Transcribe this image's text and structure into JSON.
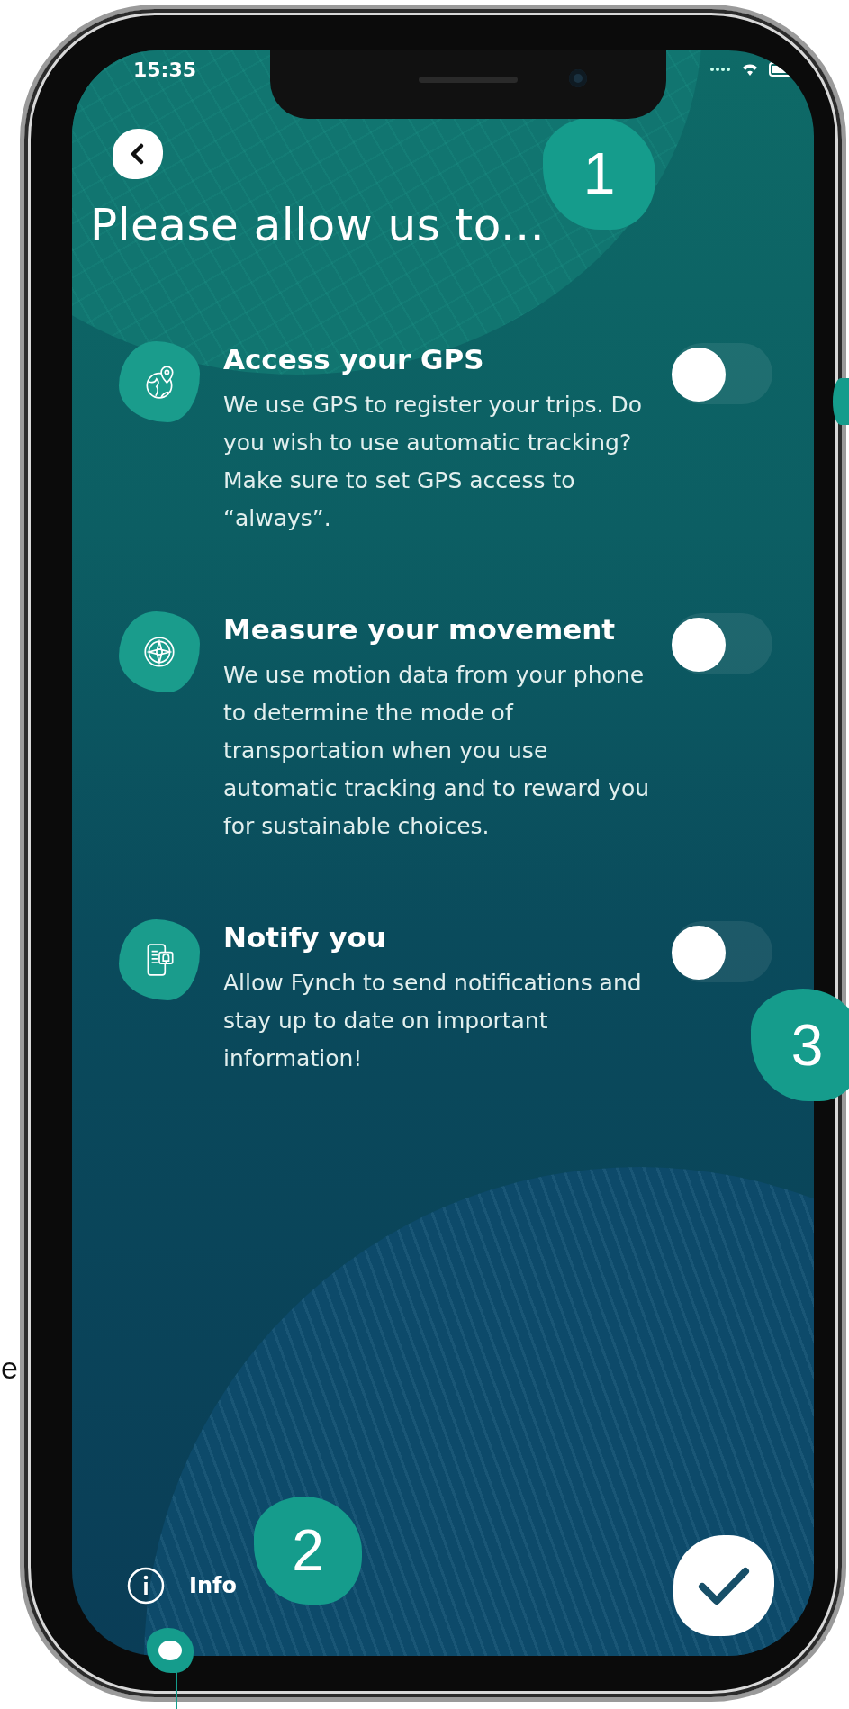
{
  "status_bar": {
    "time": "15:35"
  },
  "title": "Please allow us to...",
  "permissions": [
    {
      "kind": "gps",
      "title": "Access your GPS",
      "description": "We use GPS to register your trips. Do you wish to use automatic tracking? Make sure to set GPS access to “always”.",
      "on": false
    },
    {
      "kind": "motion",
      "title": "Measure your movement",
      "description": "We use motion data from your phone to determine the mode of transportation when you use automatic tracking and to reward you for sustainable choices.",
      "on": false
    },
    {
      "kind": "notify",
      "title": "Notify you",
      "description": "Allow Fynch to send notifications and stay up to date on important information!",
      "on": false
    }
  ],
  "footer": {
    "info_label": "Info"
  },
  "annotations": [
    {
      "kind": "number",
      "label": "1"
    },
    {
      "kind": "number",
      "label": "2"
    },
    {
      "kind": "number",
      "label": "3"
    },
    {
      "kind": "partial"
    },
    {
      "kind": "pin"
    }
  ],
  "margin_text": "e"
}
